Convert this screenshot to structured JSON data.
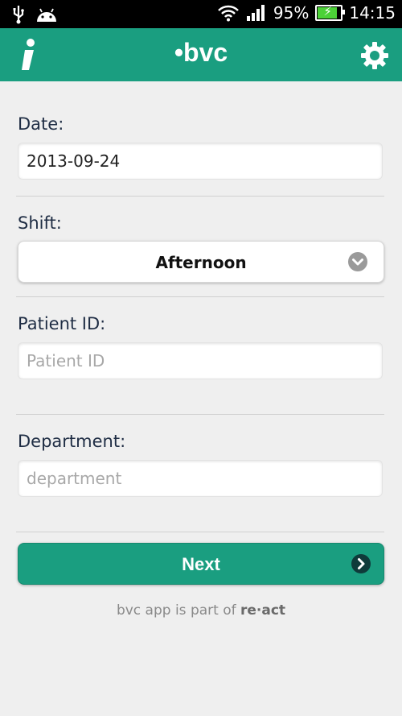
{
  "status_bar": {
    "battery": "95%",
    "time": "14:15",
    "icons": [
      "usb-icon",
      "android-icon",
      "wifi-icon",
      "signal-icon",
      "battery-icon"
    ]
  },
  "app_bar": {
    "brand": "•bvc",
    "info_icon": "info-icon",
    "settings_icon": "gear-icon",
    "color": "#1a9e80"
  },
  "form": {
    "date": {
      "label": "Date:",
      "value": "2013-09-24"
    },
    "shift": {
      "label": "Shift:",
      "selected": "Afternoon"
    },
    "patient_id": {
      "label": "Patient ID:",
      "placeholder": "Patient ID",
      "value": ""
    },
    "department": {
      "label": "Department:",
      "placeholder": "department",
      "value": ""
    }
  },
  "next_button": {
    "label": "Next"
  },
  "footer": {
    "prefix": "bvc app is part of ",
    "brand": "re·act"
  }
}
